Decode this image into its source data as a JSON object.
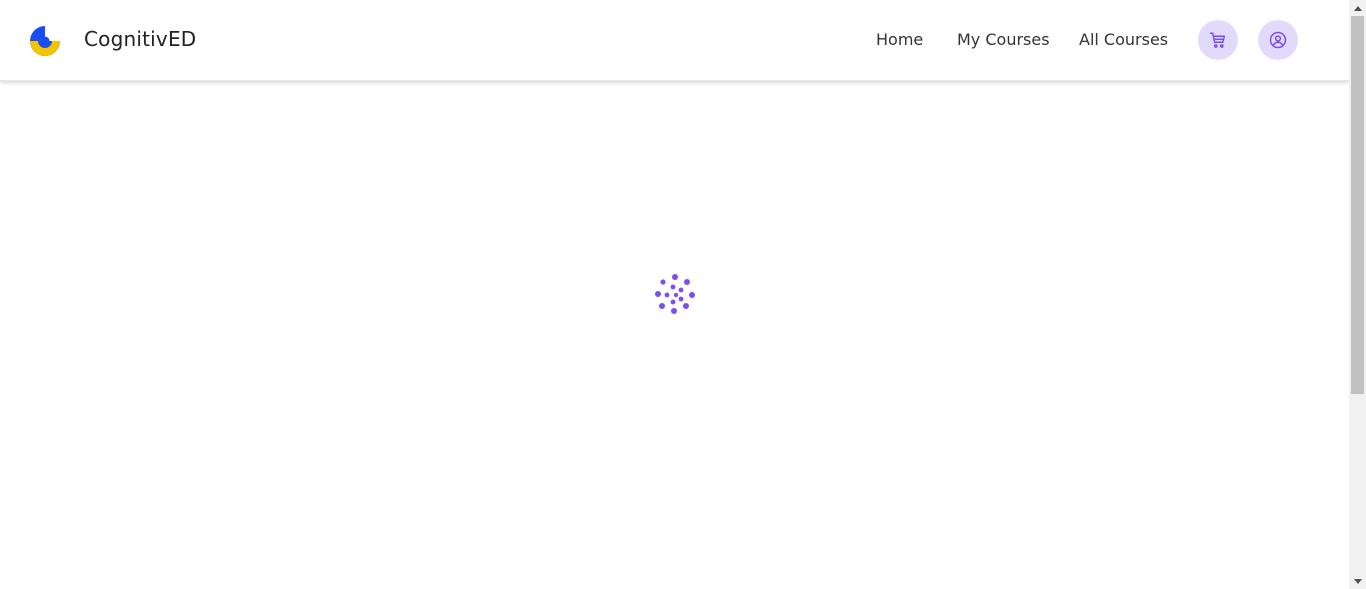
{
  "brand": {
    "name": "CognitivED",
    "colors": {
      "blue": "#1a4df0",
      "yellow": "#f5c400"
    }
  },
  "nav": {
    "links": [
      {
        "label": "Home"
      },
      {
        "label": "My Courses"
      },
      {
        "label": "All Courses"
      }
    ],
    "cart_icon": "cart-icon",
    "account_icon": "user-circle-icon"
  },
  "loader": {
    "icon": "loading-spinner-icon",
    "color": "#7c4ef0"
  },
  "theme": {
    "accent": "#7c4ef0",
    "icon_button_bg": "#e2dafa"
  }
}
